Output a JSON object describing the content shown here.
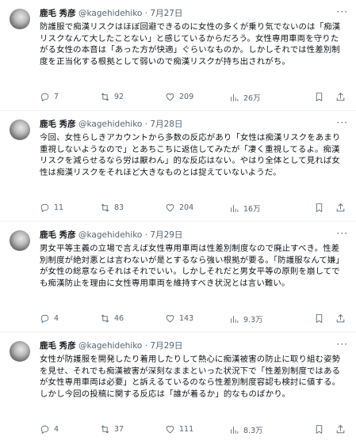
{
  "tweets": [
    {
      "name": "鹿毛 秀彦",
      "handle": "@kagehidehiko",
      "dot": "·",
      "date": "7月27日",
      "text": "防護服で痴漢リスクはほぼ回避できるのに女性の多くが乗り気でないのは「痴漢リスクなんて大したことない」と感じているからだろう。女性専用車両を守りたがる女性の本音は「あった方が快適」ぐらいなものか。しかしそれでは性差別制度を正当化する根拠として弱いので痴漢リスクが持ち出されがち。",
      "replies": "7",
      "retweets": "92",
      "likes": "209",
      "views": "26万"
    },
    {
      "name": "鹿毛 秀彦",
      "handle": "@kagehidehiko",
      "dot": "·",
      "date": "7月28日",
      "text": "今回、女性らしきアカウントから多数の反応があり「女性は痴漢リスクをあまり重視しないようなので」とあちこちに返信してみたが「凄く重視してるよ。痴漢リスクを減らせるなら労は厭わん」的な反応はない。やはり全体として見れば女性は痴漢リスクをそれほど大きなものとは捉えていないようだ。",
      "replies": "11",
      "retweets": "83",
      "likes": "204",
      "views": "16万"
    },
    {
      "name": "鹿毛 秀彦",
      "handle": "@kagehidehiko",
      "dot": "·",
      "date": "7月29日",
      "text": "男女平等主義の立場で言えば女性専用車両は性差別制度なので廃止すべき。性差別制度が絶対悪とは言わないが是とするなら強い根拠が要る。「防護服なんて嫌」が女性の総意ならそれはそれでいい。しかしそれだと男女平等の原則を崩してでも痴漢防止を理由に女性専用車両を維持すべき状況とは言い難い。",
      "replies": "4",
      "retweets": "46",
      "likes": "143",
      "views": "9.3万"
    },
    {
      "name": "鹿毛 秀彦",
      "handle": "@kagehidehiko",
      "dot": "·",
      "date": "7月29日",
      "text": "女性が防護服を開発したり着用したりして熱心に痴漢被害の防止に取り組む姿勢を見せ、それでも痴漢被害が深刻なままといった状況下で「性差別制度ではあるが女性専用車両は必要」と訴えるているのなら性差別制度容認も検討に値する。しかし今回の投稿に関する反応は「誰が着るか」的なものばかり。",
      "replies": "4",
      "retweets": "37",
      "likes": "111",
      "views": "8.3万"
    }
  ],
  "icons": [
    "avatar",
    "more-icon",
    "reply-icon",
    "retweet-icon",
    "like-icon",
    "views-icon",
    "bookmark-icon",
    "share-icon"
  ]
}
